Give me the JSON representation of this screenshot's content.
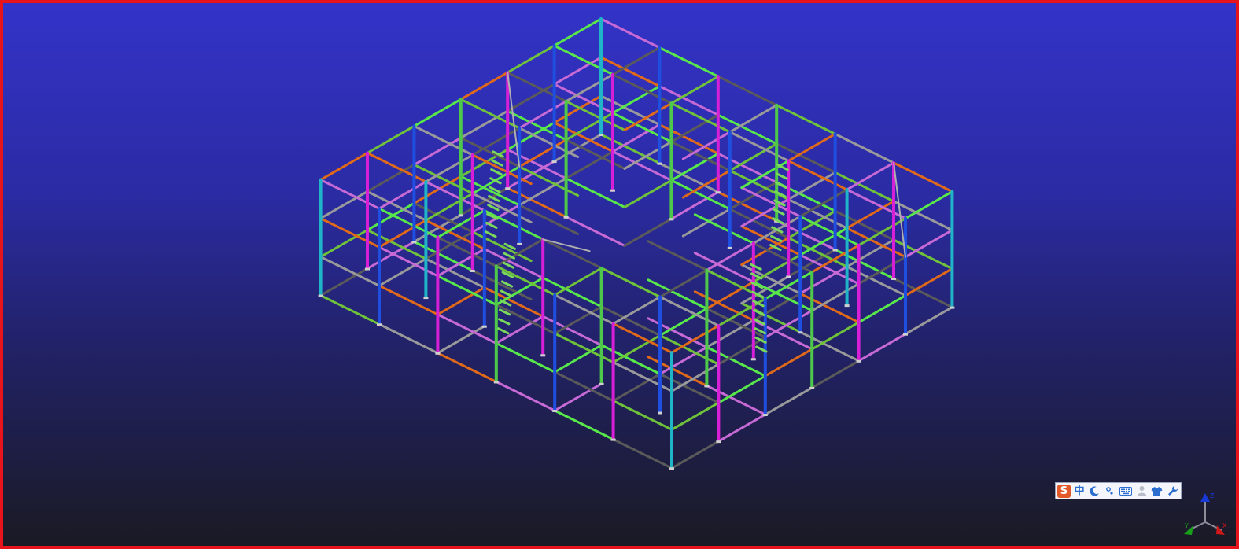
{
  "viewport": {
    "name": "3d-structural-model-view",
    "border_color": "#e8141c",
    "background_top": "#3333c8",
    "background_bottom": "#1a1a24"
  },
  "member_colors": {
    "beam_green": "#6fc23a",
    "beam_bright_green": "#58e84a",
    "beam_orange": "#e06a1a",
    "beam_gray": "#9a9a9a",
    "beam_dark_gray": "#5a5a5a",
    "beam_violet": "#c86ad6",
    "column_cyan": "#1fb4c8",
    "column_blue": "#1f4fe0",
    "column_magenta": "#d61fd6",
    "column_green": "#4ec84a",
    "stair_green": "#7ad85a",
    "brace_gray": "#b0b0b0"
  },
  "ime_toolbar": {
    "logo": "S",
    "mode_label": "中",
    "items": [
      {
        "name": "sogou-logo-icon"
      },
      {
        "name": "chinese-mode-button"
      },
      {
        "name": "moon-icon"
      },
      {
        "name": "punctuation-icon"
      },
      {
        "name": "keyboard-icon"
      },
      {
        "name": "user-icon"
      },
      {
        "name": "skin-shirt-icon"
      },
      {
        "name": "wrench-icon"
      }
    ]
  },
  "axis_triad": {
    "x_color": "#d01818",
    "y_color": "#18a018",
    "z_color": "#1838d8",
    "z_label": "Z",
    "x_label": "X",
    "y_label": "Y"
  }
}
